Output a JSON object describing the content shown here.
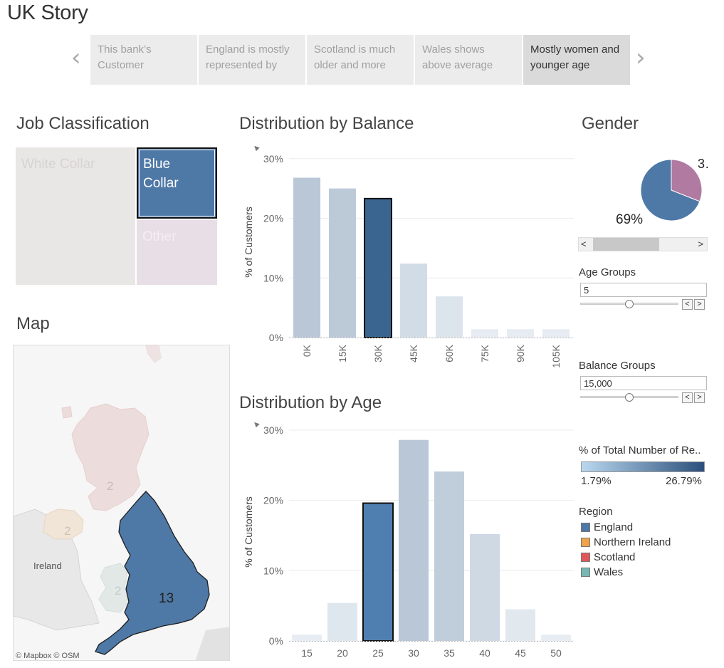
{
  "story": {
    "title": "UK Story",
    "points": [
      {
        "label": "This bank’s Customer"
      },
      {
        "label": "England is mostly represented by"
      },
      {
        "label": "Scotland is much older and more"
      },
      {
        "label": "Wales shows above average"
      },
      {
        "label": "Mostly women and younger age"
      }
    ],
    "active_index": 4
  },
  "job_classification": {
    "title": "Job Classification",
    "cells": [
      {
        "label": "White Collar",
        "color": "#e9e7e6",
        "text_color": "#d6d4d3"
      },
      {
        "label": "Blue Collar",
        "color": "#4e78a6",
        "text_color": "#ffffff",
        "selected": true
      },
      {
        "label": "Other",
        "color": "#e7dee6",
        "text_color": "#f4eef3"
      }
    ]
  },
  "map": {
    "title": "Map",
    "labels": {
      "scotland": "2",
      "northern_ireland": "2",
      "wales": "2",
      "england": "13",
      "ireland": "Ireland"
    },
    "attribution": "© Mapbox © OSM"
  },
  "balance_chart": {
    "title": "Distribution by Balance"
  },
  "age_chart": {
    "title": "Distribution by Age"
  },
  "gender": {
    "title": "Gender",
    "label_major": "69%",
    "label_minor": "3…",
    "scroll_left": "<",
    "scroll_right": ">"
  },
  "controls": {
    "age_groups": {
      "label": "Age Groups",
      "value": "5",
      "slider_fraction": 0.5
    },
    "balance_groups": {
      "label": "Balance Groups",
      "value": "15,000",
      "slider_fraction": 0.5
    },
    "step_prev": "<",
    "step_next": ">"
  },
  "color_legend": {
    "title": "% of Total Number of Re..",
    "min_label": "1.79%",
    "max_label": "26.79%",
    "min_color": "#b9d8ef",
    "max_color": "#2b4f7c"
  },
  "region_legend": {
    "title": "Region",
    "items": [
      {
        "label": "England",
        "color": "#4e78a6"
      },
      {
        "label": "Northern Ireland",
        "color": "#f0a24a"
      },
      {
        "label": "Scotland",
        "color": "#e15759"
      },
      {
        "label": "Wales",
        "color": "#76b7b2"
      }
    ]
  },
  "chart_data": [
    {
      "type": "bar",
      "title": "Distribution by Balance",
      "xlabel": "",
      "ylabel": "% of Customers",
      "categories": [
        "0K",
        "15K",
        "30K",
        "45K",
        "60K",
        "75K",
        "90K",
        "105K"
      ],
      "values": [
        26.8,
        25.0,
        23.3,
        12.4,
        6.9,
        1.4,
        1.4,
        1.4
      ],
      "highlighted": "30K",
      "ylim": [
        0,
        32
      ],
      "yticks": [
        "0%",
        "10%",
        "20%",
        "30%"
      ],
      "grid": true
    },
    {
      "type": "bar",
      "title": "Distribution by Age",
      "xlabel": "",
      "ylabel": "% of Customers",
      "categories": [
        "15",
        "20",
        "25",
        "30",
        "35",
        "40",
        "45",
        "50"
      ],
      "values": [
        0.9,
        5.4,
        19.6,
        28.6,
        24.1,
        15.2,
        4.5,
        0.9
      ],
      "highlighted": "25",
      "ylim": [
        0,
        31
      ],
      "yticks": [
        "0%",
        "10%",
        "20%",
        "30%"
      ],
      "grid": true
    },
    {
      "type": "pie",
      "title": "Gender",
      "values": [
        69,
        31
      ],
      "colors": [
        "#4e78a6",
        "#b07aa1"
      ]
    }
  ]
}
